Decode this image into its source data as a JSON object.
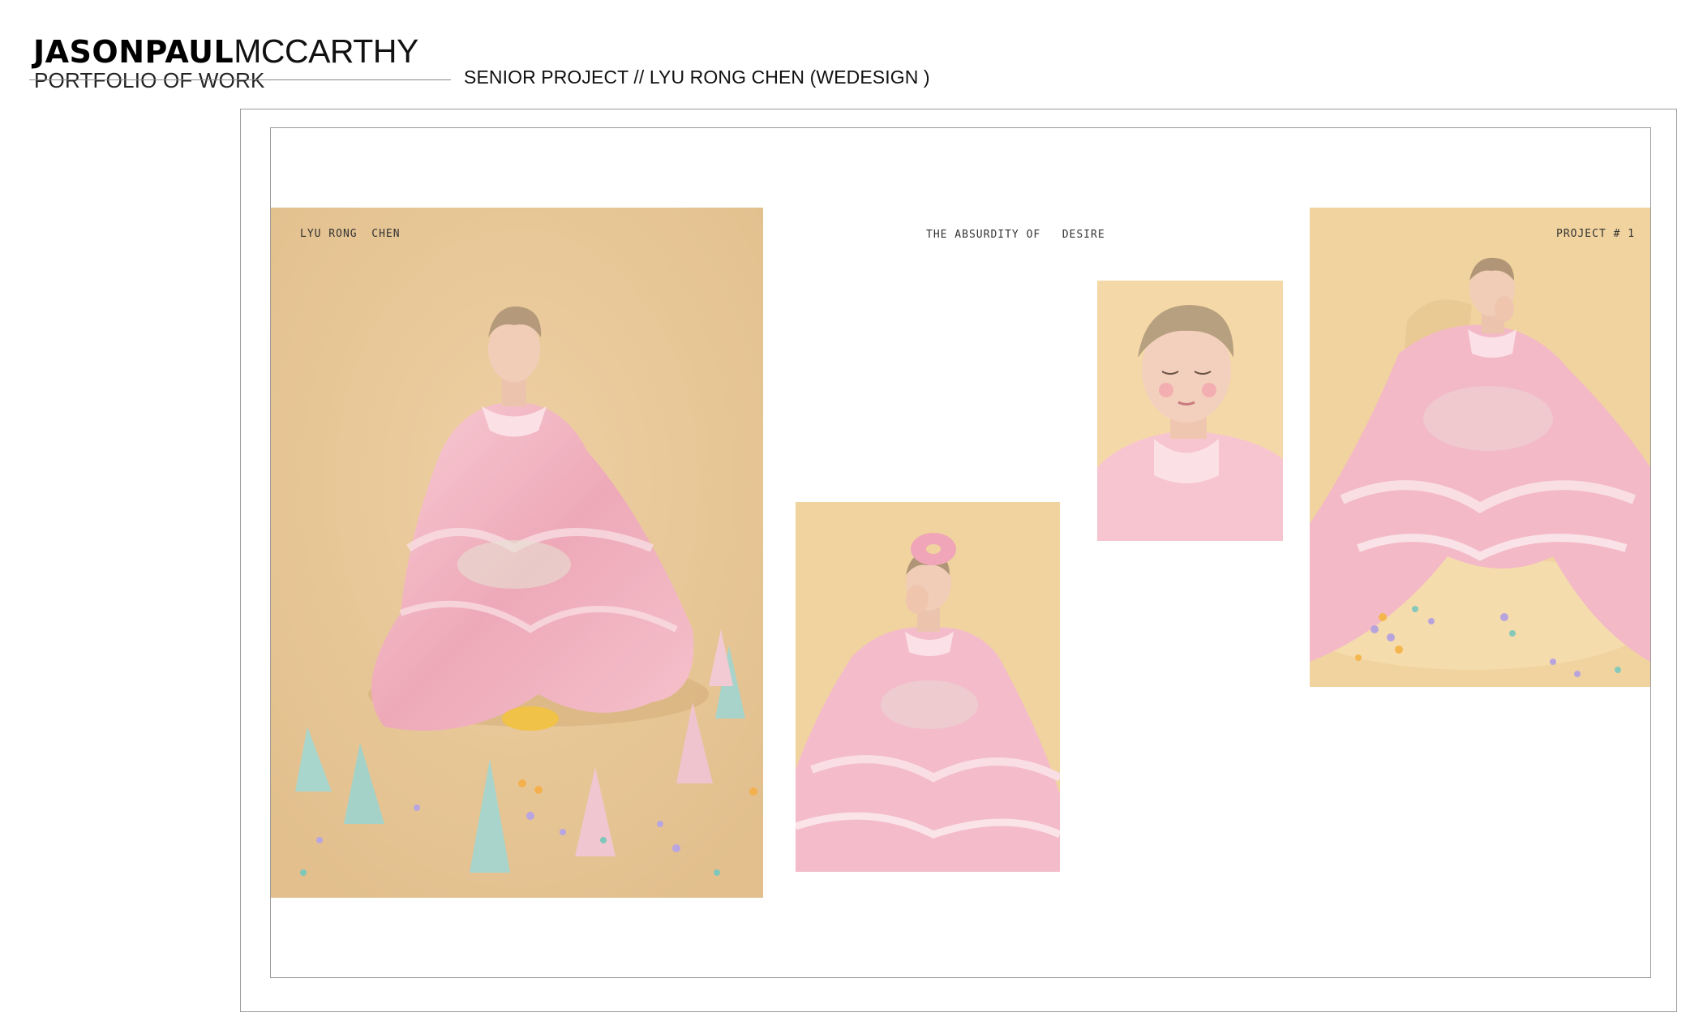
{
  "header": {
    "brand_bold": "JASONPAUL",
    "brand_light": "MCCARTHY",
    "subtitle": "PORTFOLIO OF WORK",
    "project_title": "SENIOR PROJECT // LYU RONG CHEN (WEDESIGN )"
  },
  "captions": {
    "left": "LYU RONG  CHEN",
    "center": "THE ABSURDITY OF   DESIRE",
    "right": "PROJECT # 1"
  },
  "colors": {
    "backdrop": "#e8c99a",
    "garment": "#f3b9c4",
    "accent_mint": "#9fd3c7"
  }
}
